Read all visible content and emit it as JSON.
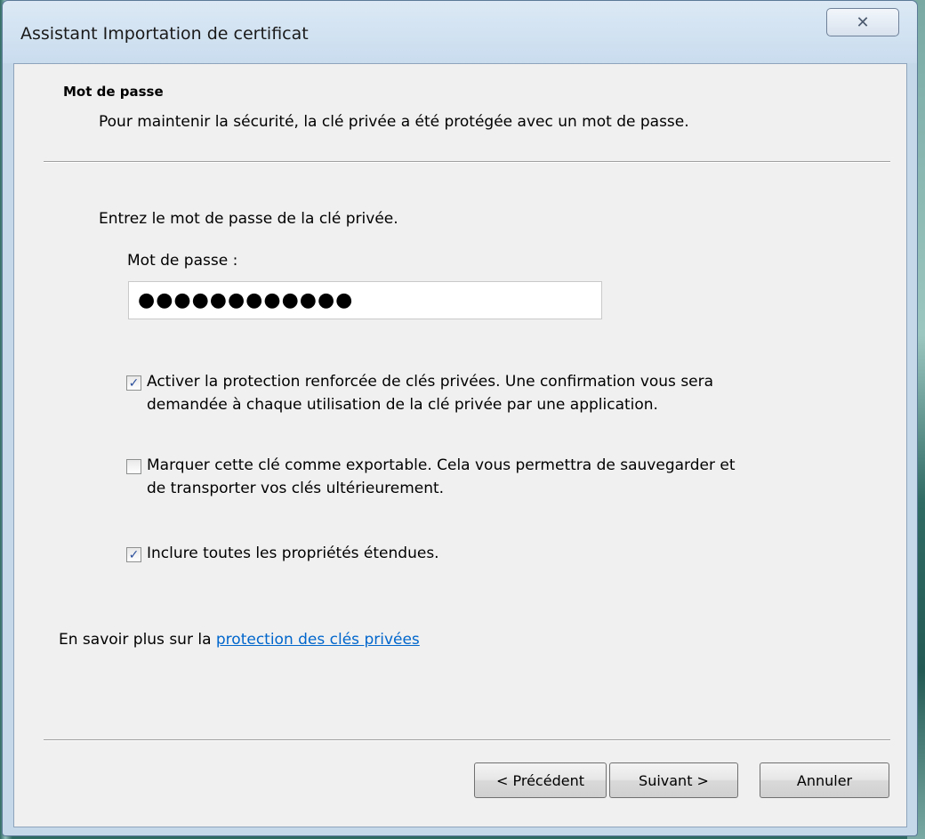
{
  "window": {
    "title": "Assistant Importation de certificat",
    "close_glyph": "✕"
  },
  "header": {
    "title": "Mot de passe",
    "description": "Pour maintenir la sécurité, la clé privée a été protégée avec un mot de passe."
  },
  "form": {
    "instruction": "Entrez le mot de passe de la clé privée.",
    "password_label": "Mot de passe :",
    "password_value": "●●●●●●●●●●●●",
    "options": [
      {
        "checked": true,
        "label_line1": "Activer la protection renforcée de clés privées. Une confirmation vous sera",
        "label_line2": "demandée à chaque utilisation de la clé privée par une application."
      },
      {
        "checked": false,
        "label_line1": "Marquer cette clé comme exportable. Cela vous permettra de sauvegarder et",
        "label_line2": "de transporter vos clés ultérieurement."
      },
      {
        "checked": true,
        "label_line1": "Inclure toutes les propriétés étendues.",
        "label_line2": ""
      }
    ],
    "check_glyph": "✓"
  },
  "learn_more": {
    "prefix": "En savoir plus sur la ",
    "link": "protection des clés privées"
  },
  "buttons": {
    "back": "< Précédent",
    "next": "Suivant >",
    "cancel": "Annuler"
  },
  "colors": {
    "link": "#0066cc",
    "checkmark": "#2b4f9c",
    "window_frame": "#c5d8ea",
    "client_bg": "#f0f0f0"
  }
}
